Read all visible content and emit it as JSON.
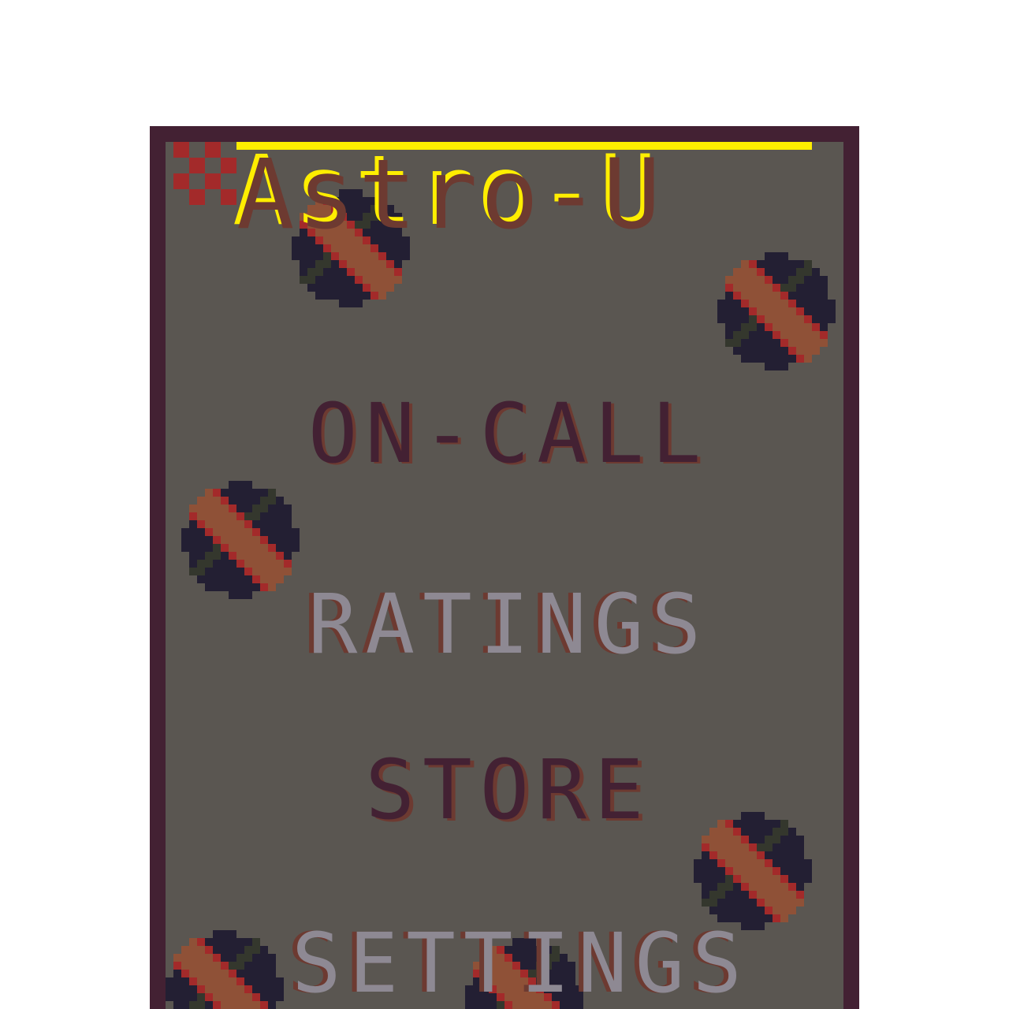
{
  "game": {
    "title": "Astro-U",
    "menu": {
      "items": [
        {
          "id": "on-call",
          "label": "ON-CALL"
        },
        {
          "id": "ratings",
          "label": "RATINGS"
        },
        {
          "id": "store",
          "label": "STORE"
        },
        {
          "id": "settings",
          "label": "SETTINGS"
        }
      ]
    }
  },
  "colors": {
    "background": "#ffffff",
    "frame": "#432133",
    "panel": "#5a5651",
    "title_yellow": "#ffee00",
    "title_brown": "#6d3a31",
    "menu_dark": "#432133",
    "menu_light": "#8e8993",
    "burger_bun": "#8f5137",
    "burger_dark": "#231f33",
    "burger_red": "#a32a2a",
    "burger_green": "#34372d"
  },
  "icons": {
    "logo": "checker-icon",
    "decor": "burger-icon"
  }
}
